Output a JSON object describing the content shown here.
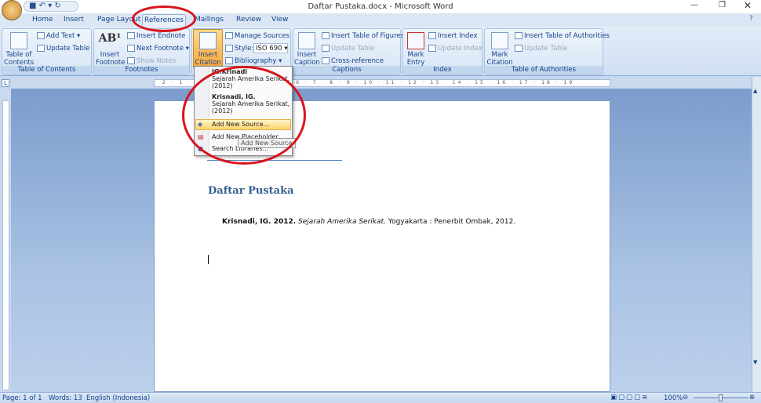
{
  "window": {
    "title": "Daftar Pustaka.docx - Microsoft Word"
  },
  "tabs": [
    "Home",
    "Insert",
    "Page Layout",
    "References",
    "Mailings",
    "Review",
    "View"
  ],
  "ribbon": {
    "toc": {
      "big": "Table of Contents",
      "add_text": "Add Text",
      "update_table": "Update Table",
      "label": "Table of Contents"
    },
    "footnotes": {
      "big": "Insert Footnote",
      "insert_endnote": "Insert Endnote",
      "next_footnote": "Next Footnote",
      "show_notes": "Show Notes",
      "label": "Footnotes"
    },
    "citations": {
      "big": "Insert Citation",
      "manage_sources": "Manage Sources",
      "style_label": "Style:",
      "style_value": "ISO 690",
      "bibliography": "Bibliography"
    },
    "captions": {
      "big": "Insert Caption",
      "insert_tof": "Insert Table of Figures",
      "update_table": "Update Table",
      "cross_ref": "Cross-reference",
      "label": "Captions"
    },
    "index": {
      "big": "Mark Entry",
      "insert_index": "Insert Index",
      "update_index": "Update Index",
      "label": "Index"
    },
    "toa": {
      "big": "Mark Citation",
      "insert_toa": "Insert Table of Authorities",
      "update_table": "Update Table",
      "label": "Table of Authorities"
    }
  },
  "citation_menu": {
    "items": [
      {
        "author": "IG.Krinadi",
        "title": "Sejarah Amerika Serikat, (2012)"
      },
      {
        "author": "Krisnadi, IG.",
        "title": "Sejarah Amerika Serikat, (2012)"
      }
    ],
    "add_new_source": "Add New Source...",
    "add_new_placeholder": "Add New Placeholder...",
    "search_libraries": "Search Libraries...",
    "tooltip": "Add New Source"
  },
  "ruler": "· 2 · 1 · · · 1 · 2 · 3 · 4 · 5 · 6 · 7 · 8 · 9 · 10 · 11 · 12 · 13 · 14 · 15 · 16 · 17 · 18 · 19",
  "document": {
    "heading": "Daftar Pustaka",
    "entry_author": "Krisnadi, IG. 2012.",
    "entry_title": "Sejarah Amerika Serikat.",
    "entry_rest": " Yogyakarta : Penerbit Ombak, 2012."
  },
  "status": {
    "page": "Page: 1 of 1",
    "words": "Words: 13",
    "language": "English (Indonesia)",
    "zoom": "100%"
  },
  "colors": {
    "accent_ring": "#d8141c",
    "heading": "#365f91",
    "ribbon": "#dbe6f4"
  }
}
